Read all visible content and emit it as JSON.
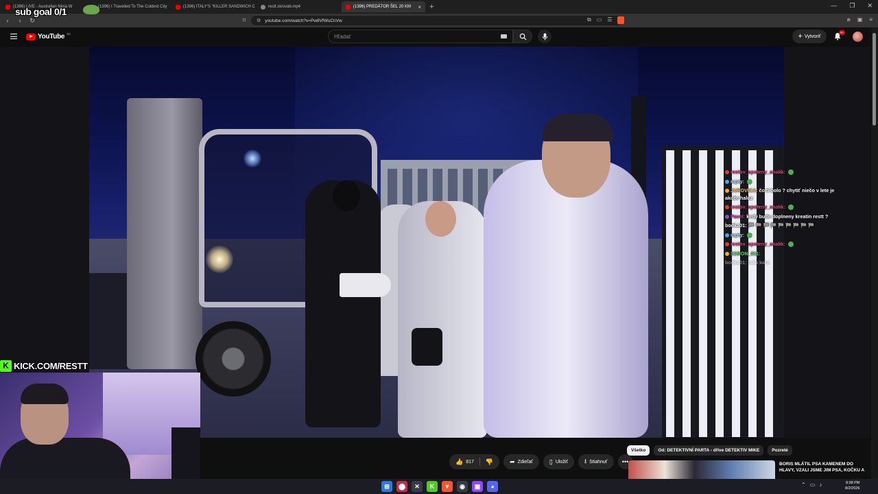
{
  "overlay": {
    "sub_goal": "sub goal 0/1",
    "kick_link": "KICK.COM/RESTT",
    "kick_logo_letter": "K"
  },
  "browser": {
    "tabs": [
      {
        "label": "(1396) LIVE - Australian Ninja W",
        "active": false,
        "favicon": "youtube-icon"
      },
      {
        "label": "(1396) I Travelled To The Coldest City",
        "active": false,
        "favicon": "youtube-icon"
      },
      {
        "label": "(1396) ITALY'S \"KILLER SANDWICH C",
        "active": false,
        "favicon": "youtube-icon"
      },
      {
        "label": "restt.sk/svab.mp4",
        "active": false,
        "favicon": "globe-icon"
      },
      {
        "label": "(1396) PREDÁTOR ŠEL 20 KM",
        "active": true,
        "favicon": "youtube-icon"
      }
    ],
    "new_tab": "+",
    "url": "youtube.com/watch?v=Pw8VfWuCnVw"
  },
  "youtube": {
    "logo": "YouTube",
    "region": "SK",
    "search_placeholder": "Hľadať",
    "create_label": "Vytvoriť",
    "notifications_badge": "9+"
  },
  "chat": [
    {
      "user": "restov_spoteny_analik:",
      "msg": "",
      "color": "#e0457b",
      "badge": "#e53935",
      "verified": true,
      "faded": false
    },
    {
      "user": "rapty:",
      "msg": "",
      "color": "#b7e0ff",
      "badge": "#42a5f5",
      "verified": true,
      "faded": false
    },
    {
      "user": "JUROVICA:",
      "msg": "čo ti bolo ? chytiť niečo v lete je akože haluz",
      "color": "#f3c969",
      "badge": "#ffa726",
      "verified": false,
      "faded": false
    },
    {
      "user": "restov_spoteny_analik:",
      "msg": "",
      "color": "#e0457b",
      "badge": "#e53935",
      "verified": true,
      "faded": false
    },
    {
      "user": "Pavel:",
      "msg": "kedy bude doplneny kreatin restt ?",
      "color": "#d6409f",
      "badge": "#7e57c2",
      "verified": false,
      "faded": false
    },
    {
      "user": "bodka01:",
      "msg": "🏁 🏁 🏁 🏁 🏁 🏁 🏁 🏁 🏁",
      "color": "#ffffff",
      "badge": "",
      "verified": false,
      "faded": false
    },
    {
      "user": "rapty:",
      "msg": "",
      "color": "#b7e0ff",
      "badge": "#42a5f5",
      "verified": true,
      "faded": false
    },
    {
      "user": "restov_spoteny_analik:",
      "msg": "",
      "color": "#e0457b",
      "badge": "#e53935",
      "verified": true,
      "faded": false
    },
    {
      "user": "S1MON_011:",
      "msg": "",
      "color": "#63e06a",
      "badge": "#ffa726",
      "verified": false,
      "faded": false
    },
    {
      "user": "bodka01:",
      "msg": "taka kara",
      "color": "#ffffff",
      "badge": "",
      "verified": false,
      "faded": true
    }
  ],
  "actions": {
    "likes": "817",
    "share": "Zdieľať",
    "save": "Uložiť",
    "download": "Stiahnuť"
  },
  "chips": [
    "Všetko",
    "Od: DETEKTIVNÍ PARTA - dříve DETEKTIV MIKE",
    "Pozreté"
  ],
  "recommended": {
    "title": "BORIS MLÁTIL PSA KAMENEM DO HLAVY, VZALI JSME JIM PSA, KOČKU A"
  },
  "taskbar": {
    "time": "9:38 PM",
    "date": "8/2/2026"
  },
  "colors": {
    "youtube_red": "#ff0000",
    "kick_green": "#53fc18",
    "background": "#0f0f0f"
  }
}
